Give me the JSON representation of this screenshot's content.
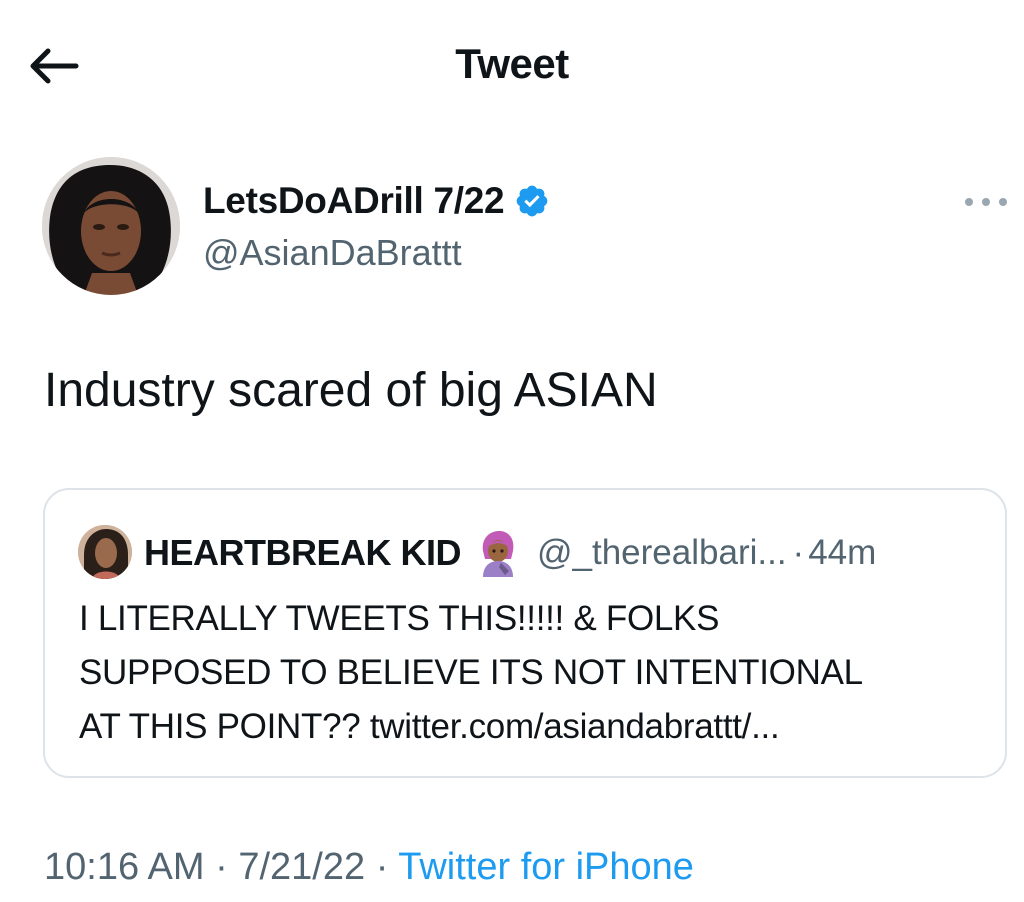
{
  "header": {
    "title": "Tweet"
  },
  "author": {
    "name": "LetsDoADrill 7/22",
    "handle": "@AsianDaBrattt",
    "verified": true
  },
  "tweet": {
    "text": "Industry scared of big ASIAN",
    "time": "10:16 AM",
    "date": "7/21/22",
    "source": "Twitter for iPhone",
    "separator": "·"
  },
  "quoted_tweet": {
    "name": "HEARTBREAK KID",
    "handle": "@_therealbari...",
    "separator": "·",
    "age": "44m",
    "text_lines": [
      "I LITERALLY TWEETS THIS!!!!! & FOLKS",
      "SUPPOSED TO BELIEVE ITS NOT INTENTIONAL",
      "AT THIS POINT?? twitter.com/asiandabrattt/..."
    ]
  },
  "icons": {
    "back": "arrow-left-icon",
    "verified": "verified-badge-icon",
    "more": "more-horizontal-icon",
    "emoji": "woman-with-purple-hair-emoji"
  },
  "colors": {
    "text_primary": "#0f1419",
    "text_secondary": "#536471",
    "link": "#1d9bf0",
    "verified": "#1d9bf0",
    "border": "#dde3e8"
  }
}
